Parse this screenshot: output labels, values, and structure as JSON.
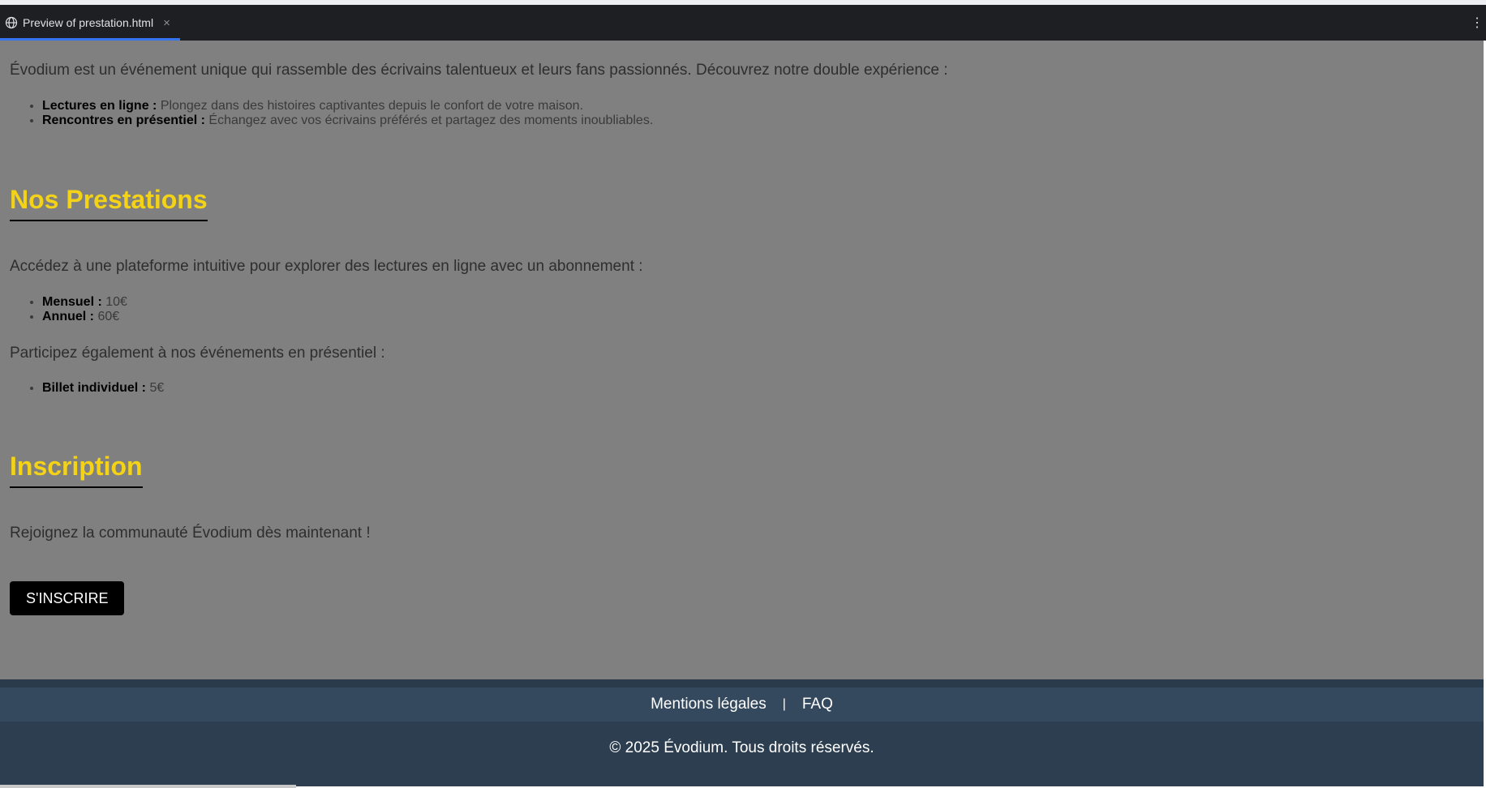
{
  "tab": {
    "title": "Preview of prestation.html",
    "close_glyph": "×",
    "icon": "globe-icon",
    "menu_glyph": "⋮"
  },
  "intro": {
    "text": "Évodium est un événement unique qui rassemble des écrivains talentueux et leurs fans passionnés. Découvrez notre double expérience :",
    "items": [
      {
        "label": "Lectures en ligne :",
        "text": "Plongez dans des histoires captivantes depuis le confort de votre maison."
      },
      {
        "label": "Rencontres en présentiel :",
        "text": "Échangez avec vos écrivains préférés et partagez des moments inoubliables."
      }
    ]
  },
  "prestations": {
    "heading": "Nos Prestations",
    "online_text": "Accédez à une plateforme intuitive pour explorer des lectures en ligne avec un abonnement :",
    "online_items": [
      {
        "label": "Mensuel :",
        "text": "10€"
      },
      {
        "label": "Annuel :",
        "text": "60€"
      }
    ],
    "event_text": "Participez également à nos événements en présentiel :",
    "event_items": [
      {
        "label": "Billet individuel :",
        "text": "5€"
      }
    ]
  },
  "inscription": {
    "heading": "Inscription",
    "text": "Rejoignez la communauté Évodium dès maintenant !",
    "button_label": "S'INSCRIRE"
  },
  "footer": {
    "links": [
      "Mentions légales",
      "FAQ"
    ],
    "separator": "|",
    "copyright": "© 2025 Évodium. Tous droits réservés."
  },
  "colors": {
    "heading": "#f4d316",
    "content_bg": "#808080",
    "footer_bg": "#2c3e50",
    "tab_accent": "#3574f0"
  }
}
